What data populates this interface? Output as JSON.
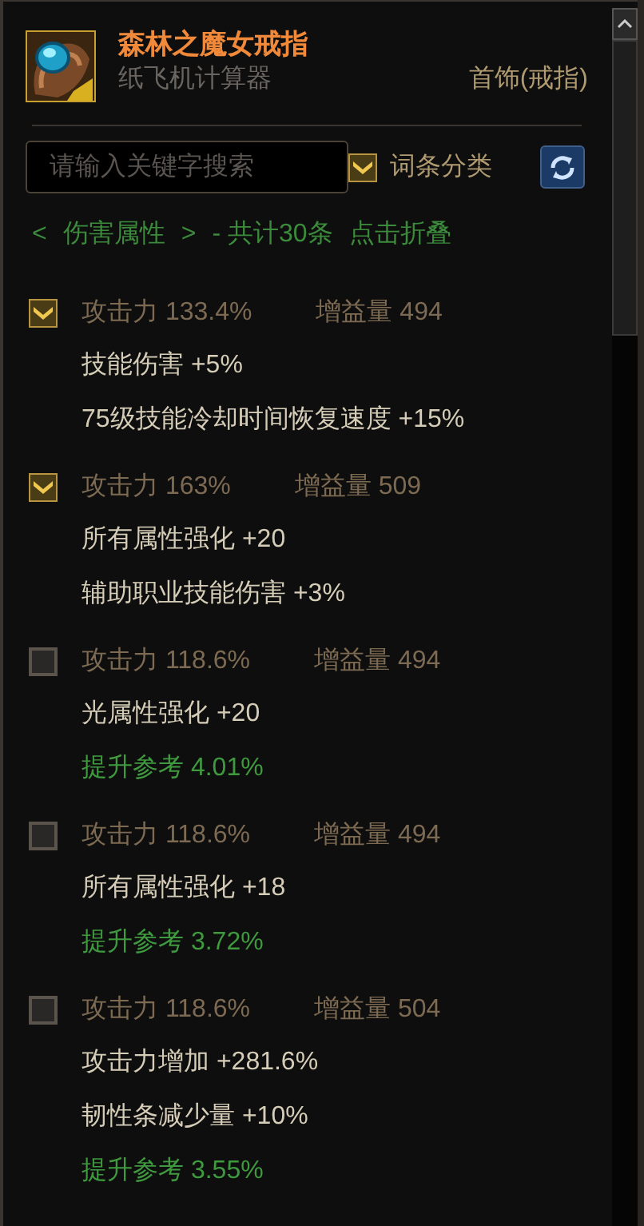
{
  "item": {
    "name": "森林之魔女戒指",
    "source": "纸飞机计算器",
    "slot": "首饰(戒指)"
  },
  "search": {
    "placeholder": "请输入关键字搜索"
  },
  "classify": {
    "label": "词条分类",
    "checked": true
  },
  "group_header": {
    "prev": "<",
    "name": "伤害属性",
    "next": ">",
    "summary": "- 共计30条",
    "toggle": "点击折叠"
  },
  "entries": [
    {
      "checked": true,
      "attack": "攻击力 133.4%",
      "gain": "增益量 494",
      "lines": [
        {
          "kind": "stat",
          "text": "技能伤害 +5%"
        },
        {
          "kind": "stat",
          "text": "75级技能冷却时间恢复速度 +15%"
        }
      ]
    },
    {
      "checked": true,
      "attack": "攻击力 163%",
      "gain": "增益量 509",
      "lines": [
        {
          "kind": "stat",
          "text": "所有属性强化 +20"
        },
        {
          "kind": "stat",
          "text": "辅助职业技能伤害 +3%"
        }
      ]
    },
    {
      "checked": false,
      "attack": "攻击力 118.6%",
      "gain": "增益量 494",
      "lines": [
        {
          "kind": "stat",
          "text": "光属性强化 +20"
        },
        {
          "kind": "reference",
          "text": "提升参考 4.01%"
        }
      ]
    },
    {
      "checked": false,
      "attack": "攻击力 118.6%",
      "gain": "增益量 494",
      "lines": [
        {
          "kind": "stat",
          "text": "所有属性强化 +18"
        },
        {
          "kind": "reference",
          "text": "提升参考 3.72%"
        }
      ]
    },
    {
      "checked": false,
      "attack": "攻击力 118.6%",
      "gain": "增益量 504",
      "lines": [
        {
          "kind": "stat",
          "text": "攻击力增加 +281.6%"
        },
        {
          "kind": "stat",
          "text": "韧性条减少量 +10%"
        },
        {
          "kind": "reference",
          "text": "提升参考 3.55%"
        }
      ]
    }
  ]
}
